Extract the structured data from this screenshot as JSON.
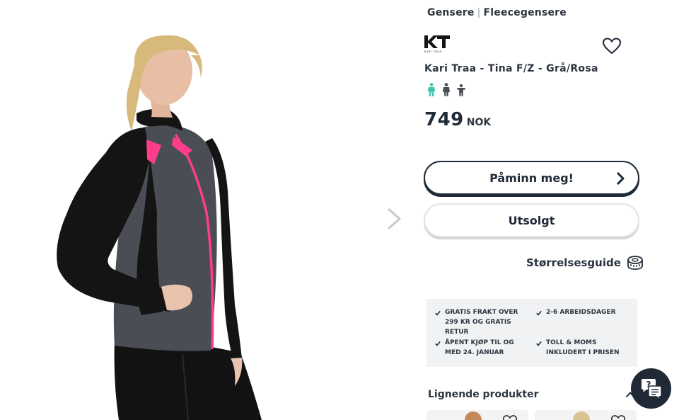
{
  "breadcrumb": {
    "items": [
      "Gensere",
      "Fleecegensere"
    ],
    "separator": "|"
  },
  "brand": {
    "logo_icon": "kari-traa-logo",
    "logo_caption": "KARI TRAA"
  },
  "product": {
    "title": "Kari Traa - Tina F/Z - Grå/Rosa",
    "price": "749",
    "currency": "NOK",
    "genders": [
      "female-icon",
      "male-icon",
      "child-icon"
    ]
  },
  "buttons": {
    "remind": "Påminn meg!",
    "sold_out": "Utsolgt"
  },
  "size_guide": {
    "label": "Størrelsesguide",
    "icon": "measuring-tape-icon"
  },
  "usps": [
    "GRATIS FRAKT OVER 299 KR OG GRATIS RETUR",
    "2-6 ARBEIDSDAGER",
    "ÅPENT KJØP TIL OG MED 24. JANUAR",
    "TOLL & MOMS INKLUDERT I PRISEN"
  ],
  "similar": {
    "title": "Lignende produkter"
  },
  "colors": {
    "text": "#1f2a36",
    "usp_background": "#f1f2f3",
    "gender_active": "#3fc5b0",
    "gender_inactive": "#4a4f55",
    "jacket_black": "#141414",
    "jacket_grey": "#4b4d55",
    "jacket_pink": "#ff3d8a"
  }
}
